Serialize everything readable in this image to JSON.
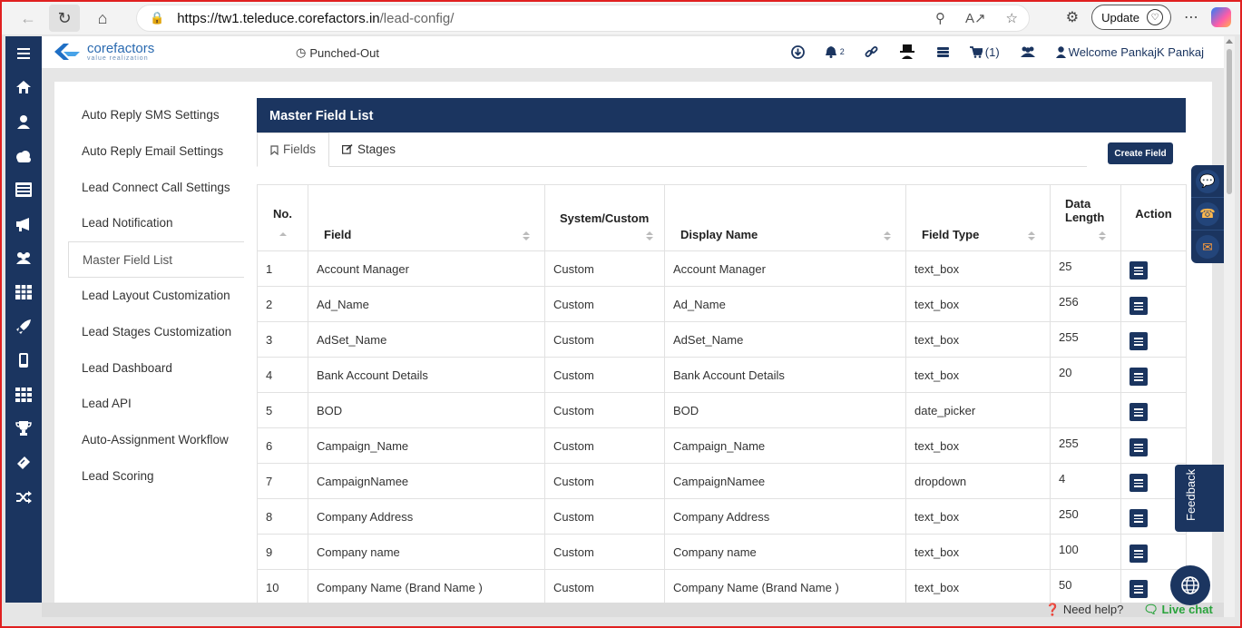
{
  "browser": {
    "url_host": "https://tw1.teleduce.corefactors.in",
    "url_path": "/lead-config/",
    "update_label": "Update"
  },
  "header": {
    "logo_name": "corefactors",
    "logo_tag": "value realization",
    "punch_status": "Punched-Out",
    "notification_count": "2",
    "cart_label": "(1)",
    "welcome_text": "Welcome PankajK Pankaj"
  },
  "submenu": [
    "Auto Reply SMS Settings",
    "Auto Reply Email Settings",
    "Lead Connect Call Settings",
    "Lead Notification",
    "Master Field List",
    "Lead Layout Customization",
    "Lead Stages Customization",
    "Lead Dashboard",
    "Lead API",
    "Auto-Assignment Workflow",
    "Lead Scoring"
  ],
  "panel": {
    "title": "Master Field List",
    "tab_fields": "Fields",
    "tab_stages": "Stages",
    "create_button": "Create Field"
  },
  "table": {
    "headers": {
      "no": "No.",
      "field": "Field",
      "system": "System/Custom",
      "display": "Display Name",
      "type": "Field Type",
      "length": "Data Length",
      "action": "Action"
    },
    "rows": [
      [
        "1",
        "Account Manager",
        "Custom",
        "Account Manager",
        "text_box",
        "25"
      ],
      [
        "2",
        "Ad_Name",
        "Custom",
        "Ad_Name",
        "text_box",
        "256"
      ],
      [
        "3",
        "AdSet_Name",
        "Custom",
        "AdSet_Name",
        "text_box",
        "255"
      ],
      [
        "4",
        "Bank Account Details",
        "Custom",
        "Bank Account Details",
        "text_box",
        "20"
      ],
      [
        "5",
        "BOD",
        "Custom",
        "BOD",
        "date_picker",
        ""
      ],
      [
        "6",
        "Campaign_Name",
        "Custom",
        "Campaign_Name",
        "text_box",
        "255"
      ],
      [
        "7",
        "CampaignNamee",
        "Custom",
        "CampaignNamee",
        "dropdown",
        "4"
      ],
      [
        "8",
        "Company Address",
        "Custom",
        "Company Address",
        "text_box",
        "250"
      ],
      [
        "9",
        "Company name",
        "Custom",
        "Company name",
        "text_box",
        "100"
      ],
      [
        "10",
        "Company Name (Brand Name )",
        "Custom",
        "Company Name (Brand Name )",
        "text_box",
        "50"
      ]
    ]
  },
  "widgets": {
    "feedback_label": "Feedback",
    "need_help": "Need help?",
    "live_chat": "Live chat"
  },
  "colors": {
    "primary": "#1b3560",
    "accent_red": "#e02020",
    "live_chat_green": "#2aa33c"
  }
}
